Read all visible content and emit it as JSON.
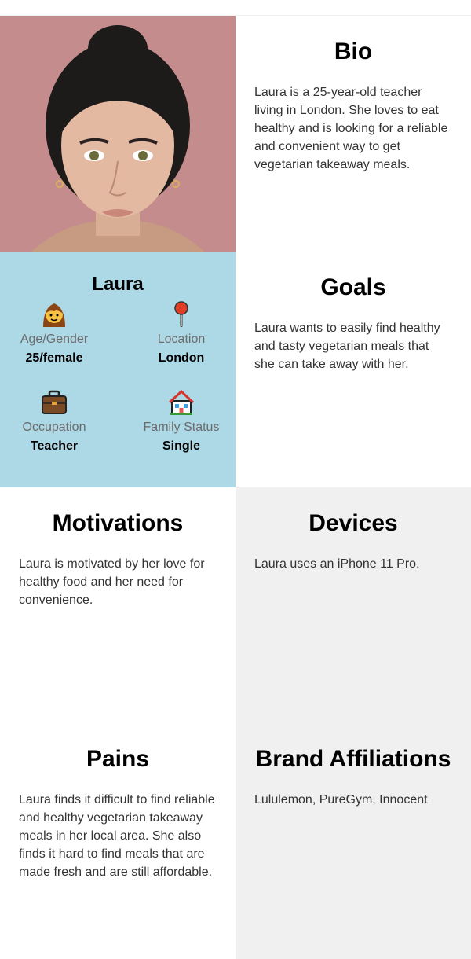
{
  "persona": {
    "bio": {
      "title": "Bio",
      "text": "Laura is a 25-year-old teacher living in London. She loves to eat healthy and is looking for a reliable and convenient way to get vegetarian takeaway meals."
    },
    "profile": {
      "name": "Laura",
      "stats": [
        {
          "label": "Age/Gender",
          "value": "25/female",
          "icon": "woman-icon"
        },
        {
          "label": "Location",
          "value": "London",
          "icon": "pin-icon"
        },
        {
          "label": "Occupation",
          "value": "Teacher",
          "icon": "briefcase-icon"
        },
        {
          "label": "Family Status",
          "value": "Single",
          "icon": "house-icon"
        }
      ],
      "photo": "portrait-photo"
    },
    "goals": {
      "title": "Goals",
      "text": "Laura wants to easily find healthy and tasty vegetarian meals that she can take away with her."
    },
    "motivations": {
      "title": "Motivations",
      "text": "Laura is motivated by her love for healthy food and her need for convenience."
    },
    "devices": {
      "title": "Devices",
      "text": "Laura uses an iPhone 11 Pro."
    },
    "pains": {
      "title": "Pains",
      "text": "Laura finds it difficult to find reliable and healthy vegetarian takeaway meals in her local area. She also finds it hard to find meals that are made fresh and are still affordable."
    },
    "brand_affiliations": {
      "title": "Brand Affiliations",
      "text": "Lululemon, PureGym, Innocent"
    }
  },
  "colors": {
    "profile_bg": "#add8e6",
    "panel_gray": "#f0f0f0",
    "photo_bg": "#c48c8c"
  }
}
